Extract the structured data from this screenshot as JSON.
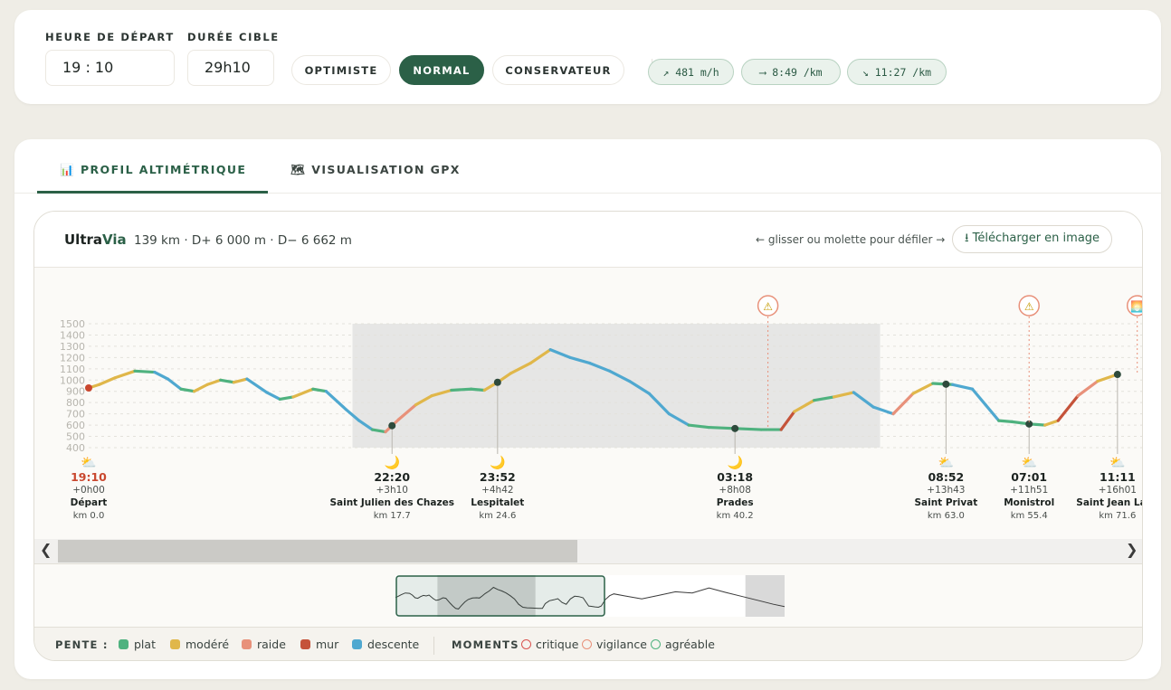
{
  "controls": {
    "start_label": "HEURE DE DÉPART",
    "start_value": "19 : 10",
    "duration_label": "DURÉE CIBLE",
    "duration_value": "29h10",
    "modes": [
      "OPTIMISTE",
      "NORMAL",
      "CONSERVATEUR"
    ],
    "active_mode": "NORMAL",
    "paces": [
      {
        "icon": "arrow-up-right-icon",
        "text": "↗ 481 m/h"
      },
      {
        "icon": "arrow-right-icon",
        "text": "⟶ 8:49 /km"
      },
      {
        "icon": "arrow-down-right-icon",
        "text": "↘ 11:27 /km"
      }
    ]
  },
  "tabs": [
    {
      "label": "PROFIL ALTIMÉTRIQUE",
      "icon": "bar-chart-icon",
      "active": true
    },
    {
      "label": "VISUALISATION GPX",
      "icon": "world-map-icon",
      "active": false
    }
  ],
  "panel": {
    "brand_main": "Ultra",
    "brand_accent": "Via",
    "stats": "139 km · D+ 6 000 m · D− 6 662 m",
    "scroll_hint": "← glisser ou molette pour défiler →",
    "download_label": "⭳ Télécharger en image"
  },
  "profile": {
    "y_ticks": [
      1500,
      1400,
      1300,
      1200,
      1100,
      1000,
      900,
      800,
      700,
      600,
      500,
      400
    ],
    "y_range": [
      400,
      1500
    ],
    "km_range": [
      0,
      80
    ],
    "elevation": [
      [
        0,
        930
      ],
      [
        0.8,
        960
      ],
      [
        2,
        1020
      ],
      [
        3.5,
        1080
      ],
      [
        5,
        1070
      ],
      [
        6,
        1010
      ],
      [
        7,
        920
      ],
      [
        8,
        900
      ],
      [
        9,
        960
      ],
      [
        10,
        1000
      ],
      [
        11,
        980
      ],
      [
        12,
        1010
      ],
      [
        13.5,
        890
      ],
      [
        14.5,
        830
      ],
      [
        15.5,
        850
      ],
      [
        17,
        920
      ],
      [
        18,
        900
      ],
      [
        19.5,
        740
      ],
      [
        20.5,
        640
      ],
      [
        21.5,
        560
      ],
      [
        22.5,
        540
      ],
      [
        23.5,
        650
      ],
      [
        24.8,
        780
      ],
      [
        26,
        860
      ],
      [
        27.5,
        910
      ],
      [
        29,
        920
      ],
      [
        30,
        910
      ],
      [
        31,
        980
      ],
      [
        32,
        1060
      ],
      [
        33.5,
        1150
      ],
      [
        35,
        1270
      ],
      [
        36.5,
        1200
      ],
      [
        38,
        1150
      ],
      [
        39.5,
        1080
      ],
      [
        41,
        990
      ],
      [
        42.5,
        880
      ],
      [
        44,
        700
      ],
      [
        45.5,
        600
      ],
      [
        47,
        580
      ],
      [
        49,
        570
      ],
      [
        51,
        560
      ],
      [
        52.5,
        560
      ],
      [
        53.5,
        720
      ],
      [
        55,
        820
      ],
      [
        56.5,
        850
      ],
      [
        58,
        890
      ],
      [
        59.5,
        760
      ],
      [
        61,
        700
      ],
      [
        62.5,
        880
      ],
      [
        64,
        970
      ],
      [
        65.5,
        960
      ],
      [
        67,
        920
      ],
      [
        68,
        780
      ],
      [
        69,
        640
      ],
      [
        70,
        630
      ],
      [
        71.3,
        610
      ],
      [
        72.5,
        600
      ],
      [
        73.5,
        640
      ],
      [
        75,
        860
      ],
      [
        76.5,
        990
      ],
      [
        78,
        1050
      ]
    ],
    "night_band_km": [
      20,
      60
    ],
    "waypoints": [
      {
        "km": 0.0,
        "time": "19:10",
        "elapsed": "+0h00",
        "name": "Départ",
        "km_label": "km 0.0",
        "icon": "partly-cloudy-icon",
        "highlight": true
      },
      {
        "km": 23.0,
        "time": "22:20",
        "elapsed": "+3h10",
        "name": "Saint Julien des Chazes",
        "km_label": "km 17.7",
        "icon": "crescent-moon-icon",
        "highlight": false
      },
      {
        "km": 31.0,
        "time": "23:52",
        "elapsed": "+4h42",
        "name": "Lespitalet",
        "km_label": "km 24.6",
        "icon": "crescent-moon-icon",
        "highlight": false
      },
      {
        "km": 49.0,
        "time": "03:18",
        "elapsed": "+8h08",
        "name": "Prades",
        "km_label": "km 40.2",
        "icon": "crescent-moon-icon",
        "highlight": false
      }
    ]
  },
  "waypoints_2": [
    {
      "time": "07:01",
      "elapsed": "+11h51",
      "name": "Monistrol",
      "km_label": "km 55.4",
      "icon": "partly-cloudy-icon"
    },
    {
      "time": "08:52",
      "elapsed": "+13h43",
      "name": "Saint Privat",
      "km_label": "km 63.0",
      "icon": "partly-cloudy-icon"
    },
    {
      "time": "11:11",
      "elapsed": "+16h01",
      "name": "Saint Jean Lach",
      "km_label": "km 71.6",
      "icon": "partly-cloudy-icon"
    }
  ],
  "moments": [
    {
      "type": "vigilance",
      "icon": "warning-icon",
      "symbol": "⚠"
    },
    {
      "type": "vigilance",
      "icon": "warning-icon",
      "symbol": "⚠"
    },
    {
      "type": "agréable",
      "icon": "sunrise-icon",
      "symbol": "🌅"
    }
  ],
  "legend": {
    "pente_label": "PENTE :",
    "pente": [
      {
        "label": "plat",
        "color": "#4fb27f"
      },
      {
        "label": "modéré",
        "color": "#e0b74a"
      },
      {
        "label": "raide",
        "color": "#e8917a"
      },
      {
        "label": "mur",
        "color": "#c5533a"
      },
      {
        "label": "descente",
        "color": "#4fa8d0"
      }
    ],
    "moments_label": "MOMENTS",
    "moments": [
      {
        "label": "critique",
        "color": "#d9534f"
      },
      {
        "label": "vigilance",
        "color": "#e8917a"
      },
      {
        "label": "agréable",
        "color": "#4fb27f"
      }
    ]
  },
  "colors": {
    "brand": "#2b6047",
    "start_time": "#c9472e",
    "marker": "#2e4a3c"
  }
}
